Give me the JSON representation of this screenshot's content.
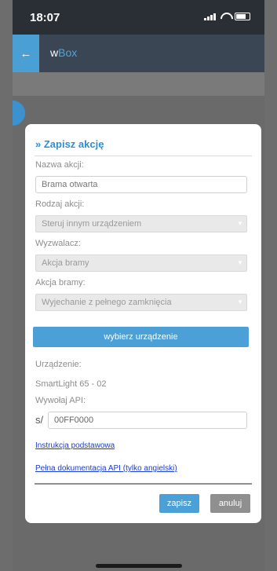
{
  "status": {
    "time": "18:07"
  },
  "appbar": {
    "back_icon": "back-arrow-icon",
    "title_prefix": "w",
    "title_suffix": "Box"
  },
  "modal": {
    "title": "» Zapisz akcję",
    "name_label": "Nazwa akcji:",
    "name_value": "Brama otwarta",
    "type_label": "Rodzaj akcji:",
    "type_value": "Steruj innym urządzeniem",
    "trigger_label": "Wyzwalacz:",
    "trigger_value": "Akcja bramy",
    "gate_action_label": "Akcja bramy:",
    "gate_action_value": "Wyjechanie z pełnego zamknięcia",
    "choose_device_button": "wybierz urządzenie",
    "device_label": "Urządzenie:",
    "device_value": "SmartLight 65 - 02",
    "api_label": "Wywołaj API:",
    "api_prefix": "s/",
    "api_value": "00FF0000",
    "link_basic": "Instrukcja podstawowa",
    "link_full_docs": "Pełna dokumentacja API (tylko angielski)",
    "save_button": "zapisz",
    "cancel_button": "anuluj"
  },
  "colors": {
    "accent": "#4aa0d7",
    "appbar": "#3a4654",
    "link": "#1a3bd6",
    "overlay": "#6a6a6a"
  }
}
